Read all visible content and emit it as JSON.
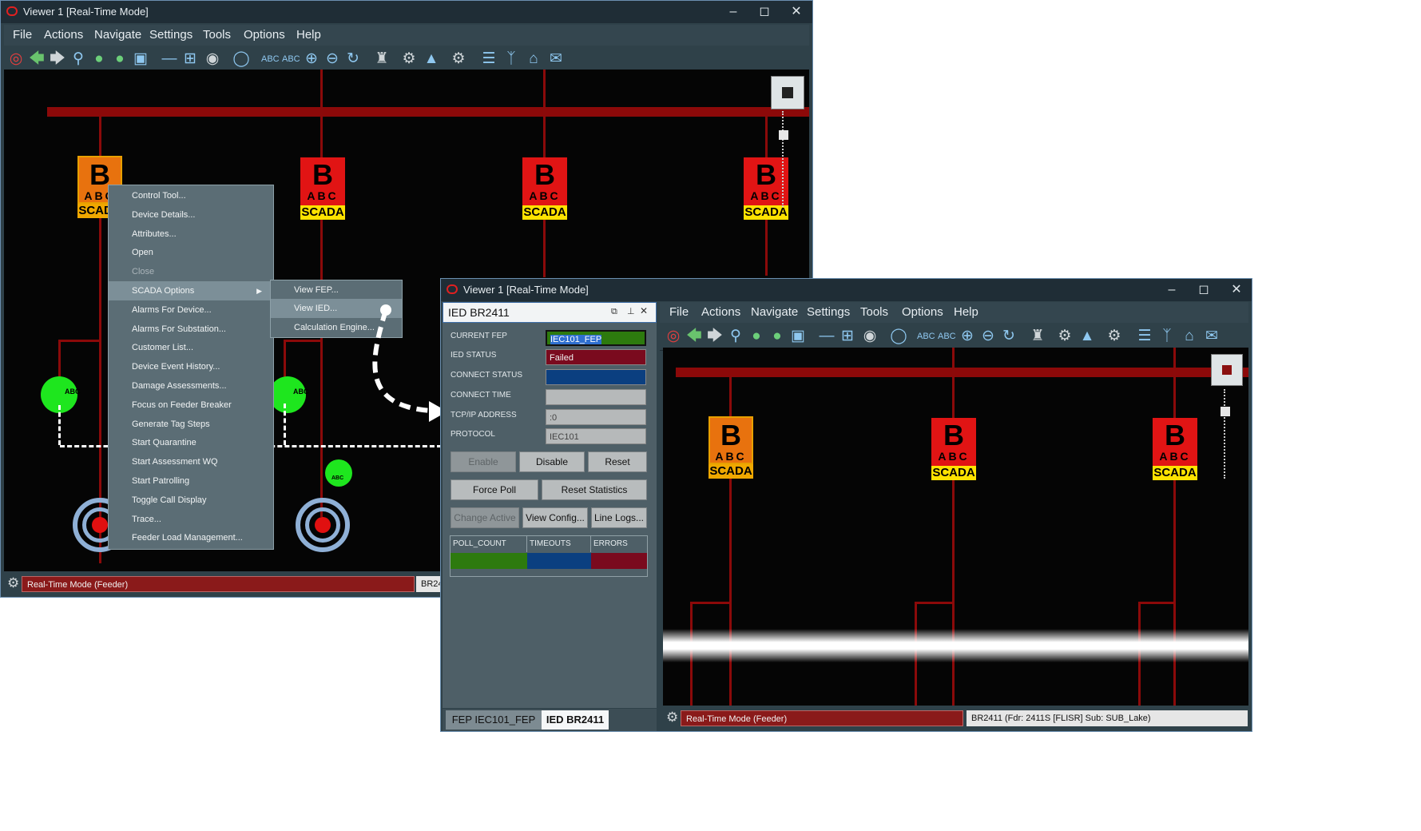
{
  "back_window": {
    "title": "Viewer 1 [Real-Time Mode]",
    "menu": [
      "File",
      "Actions",
      "Navigate",
      "Settings",
      "Tools",
      "Options",
      "Help"
    ],
    "scada_labels": {
      "big": "B",
      "abc": "ABC",
      "lab": "SCADA"
    },
    "green_label": "ABC",
    "context_menu": [
      {
        "label": "Control Tool...",
        "state": "normal"
      },
      {
        "label": "Device Details...",
        "state": "normal"
      },
      {
        "label": "Attributes...",
        "state": "normal"
      },
      {
        "label": "Open",
        "state": "normal"
      },
      {
        "label": "Close",
        "state": "disabled"
      },
      {
        "label": "SCADA Options",
        "state": "highlighted"
      },
      {
        "label": "Alarms For Device...",
        "state": "normal"
      },
      {
        "label": "Alarms For Substation...",
        "state": "normal"
      },
      {
        "label": "Customer List...",
        "state": "normal"
      },
      {
        "label": "Device Event History...",
        "state": "normal"
      },
      {
        "label": "Damage Assessments...",
        "state": "normal"
      },
      {
        "label": "Focus on Feeder Breaker",
        "state": "normal"
      },
      {
        "label": "Generate Tag Steps",
        "state": "normal"
      },
      {
        "label": "Start Quarantine",
        "state": "normal"
      },
      {
        "label": "Start Assessment WQ",
        "state": "normal"
      },
      {
        "label": "Start Patrolling",
        "state": "normal"
      },
      {
        "label": "Toggle Call Display",
        "state": "normal"
      },
      {
        "label": "Trace...",
        "state": "normal"
      },
      {
        "label": "Feeder Load Management...",
        "state": "normal"
      }
    ],
    "submenu": [
      {
        "label": "View FEP...",
        "state": "normal"
      },
      {
        "label": "View IED...",
        "state": "highlighted"
      },
      {
        "label": "Calculation Engine...",
        "state": "normal"
      }
    ],
    "status_mode": "Real-Time Mode (Feeder)",
    "status_device": "BR241"
  },
  "front_window": {
    "title": "Viewer 1 [Real-Time Mode]",
    "menu": [
      "File",
      "Actions",
      "Navigate",
      "Settings",
      "Tools",
      "Options",
      "Help"
    ],
    "status_mode": "Real-Time Mode (Feeder)",
    "status_device": "BR2411 (Fdr: 2411S [FLISR] Sub: SUB_Lake)"
  },
  "ied_panel": {
    "title": "IED BR2411",
    "fields": [
      {
        "label": "CURRENT FEP",
        "value": "IEC101_FEP",
        "color": "#2d7a0e"
      },
      {
        "label": "IED STATUS",
        "value": "Failed",
        "color": "#7a0a1e"
      },
      {
        "label": "CONNECT STATUS",
        "value": "",
        "color": "#0b3f80"
      },
      {
        "label": "CONNECT TIME",
        "value": "",
        "color": "#b6b9ba"
      },
      {
        "label": "TCP/IP ADDRESS",
        "value": ":0",
        "color": "#b6b9ba"
      },
      {
        "label": "PROTOCOL",
        "value": "IEC101",
        "color": "#b6b9ba"
      }
    ],
    "buttons": {
      "enable": "Enable",
      "disable": "Disable",
      "reset": "Reset",
      "force_poll": "Force Poll",
      "reset_statistics": "Reset Statistics",
      "change_active": "Change Active",
      "view_config": "View Config...",
      "line_logs": "Line Logs..."
    },
    "stats_headers": [
      "POLL_COUNT",
      "TIMEOUTS",
      "ERRORS"
    ],
    "stats_colors": [
      "#2d7a0e",
      "#0b3f80",
      "#7a0a1e"
    ],
    "tabs": [
      "FEP IEC101_FEP",
      "IED BR2411"
    ]
  },
  "colors": {
    "bus": "#8c0909",
    "scada_red": "#e11414",
    "scada_yellow": "#ffe200",
    "device_green": "#1ee61e",
    "status_red": "#8a1a1a"
  }
}
